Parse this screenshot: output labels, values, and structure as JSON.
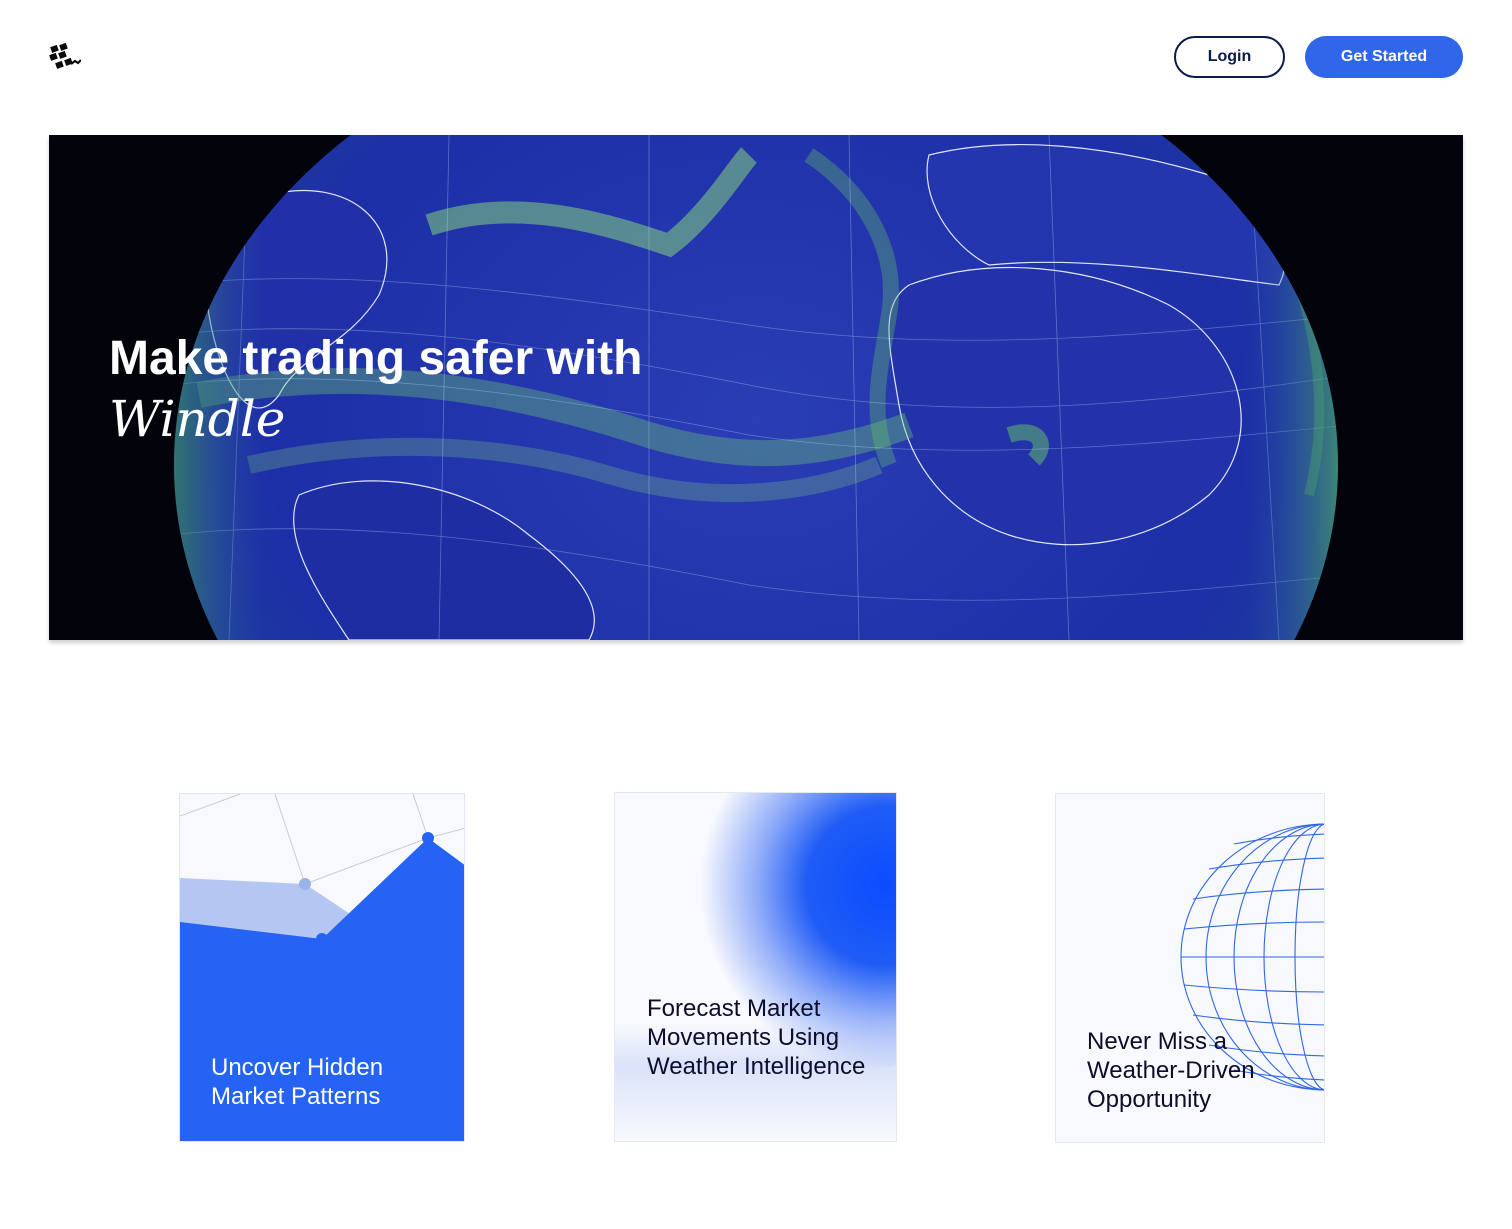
{
  "header": {
    "logo_icon": "windle-logo-icon",
    "login_label": "Login",
    "get_started_label": "Get Started"
  },
  "hero": {
    "title": "Make trading safer with",
    "brand": "Windle",
    "image_icon": "earth-wind-globe"
  },
  "features": [
    {
      "title": "Uncover Hidden Market Patterns",
      "illustration": "network-area-chart-icon"
    },
    {
      "title": "Forecast Market Movements Using Weather Intelligence",
      "illustration": "blue-gradient-blob"
    },
    {
      "title": "Never Miss a Weather-Driven Opportunity",
      "illustration": "wireframe-globe-icon"
    }
  ],
  "colors": {
    "accent": "#2f66ea",
    "login_border": "#0a1a4a",
    "hero_background": "#03030c",
    "ocean": "#1f33a8",
    "wind_green": "#5fc85a",
    "card_blue": "#2563f5"
  }
}
